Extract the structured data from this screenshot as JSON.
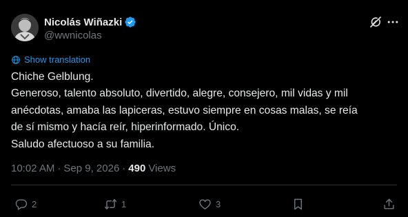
{
  "author": {
    "name": "Nicolás Wiñazki",
    "handle": "@wwnicolas"
  },
  "translation_link": "Show translation",
  "tweet_lines": [
    "Chiche Gelblung.",
    "Generoso, talento absoluto, divertido, alegre, consejero, mil vidas y mil",
    "anécdotas, amaba las lapiceras, estuvo siempre en cosas malas, se reía",
    "de sí mismo y hacía reír, hiperinformado. Único.",
    "Saludo afectuoso a su familia."
  ],
  "meta": {
    "time": "10:02 AM",
    "separator": "·",
    "date": "Sep 9, 2026",
    "views_count": "490",
    "views_label": "Views"
  },
  "actions": {
    "reply_count": "2",
    "repost_count": "1",
    "like_count": "3"
  },
  "colors": {
    "background": "#000000",
    "text": "#e7e9ea",
    "secondary": "#71767b",
    "accent": "#1d9bf0",
    "divider": "#2f3336"
  },
  "icons": [
    "verified-badge-icon",
    "grok-icon",
    "more-icon",
    "translate-icon",
    "reply-icon",
    "repost-icon",
    "like-icon",
    "bookmark-icon",
    "share-icon"
  ]
}
